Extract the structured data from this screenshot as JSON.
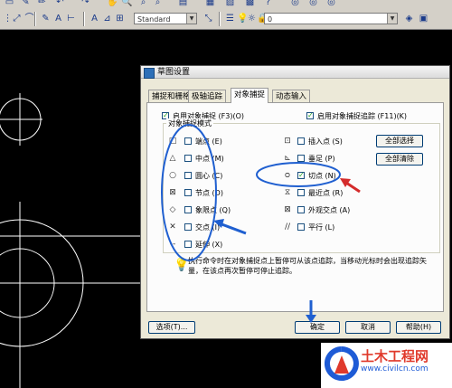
{
  "toolbar": {
    "style_combo": "Standard",
    "layer_combo": "0"
  },
  "dialog": {
    "title": "草图设置",
    "tabs": [
      "捕捉和栅格",
      "极轴追踪",
      "对象捕捉",
      "动态输入"
    ],
    "active_tab": "对象捕捉",
    "enable_snap": "启用对象捕捉 (F3)(O)",
    "enable_track": "启用对象捕捉追踪 (F11)(K)",
    "group_label": "对象捕捉模式",
    "left_modes": [
      {
        "label": "端点 (E)",
        "symbol": "□",
        "checked": false
      },
      {
        "label": "中点 (M)",
        "symbol": "△",
        "checked": false
      },
      {
        "label": "圆心 (C)",
        "symbol": "○",
        "checked": false
      },
      {
        "label": "节点 (D)",
        "symbol": "⊠",
        "checked": false
      },
      {
        "label": "象限点 (Q)",
        "symbol": "◇",
        "checked": false
      },
      {
        "label": "交点 (I)",
        "symbol": "✕",
        "checked": false
      },
      {
        "label": "延伸 (X)",
        "symbol": "--",
        "checked": false
      }
    ],
    "right_modes": [
      {
        "label": "插入点 (S)",
        "symbol": "⊡",
        "checked": false
      },
      {
        "label": "垂足 (P)",
        "symbol": "⊾",
        "checked": false
      },
      {
        "label": "切点 (N)",
        "symbol": "ᴑ",
        "checked": true
      },
      {
        "label": "最近点 (R)",
        "symbol": "⧖",
        "checked": false
      },
      {
        "label": "外观交点 (A)",
        "symbol": "⊠",
        "checked": false
      },
      {
        "label": "平行 (L)",
        "symbol": "//",
        "checked": false
      }
    ],
    "select_all": "全部选择",
    "clear_all": "全部清除",
    "tip": "执行命令时在对象捕捉点上暂停可从该点追踪，当移动光标时会出现追踪矢量，在该点再次暂停可停止追踪。",
    "options_button": "选项(T)...",
    "ok_button": "确定",
    "cancel_button": "取消",
    "help_button": "帮助(H)"
  },
  "watermark": {
    "title": "土木工程网",
    "url": "www.civilcn.com"
  },
  "colors": {
    "annotation_blue": "#1f5fd0",
    "annotation_red": "#d42b2b"
  }
}
